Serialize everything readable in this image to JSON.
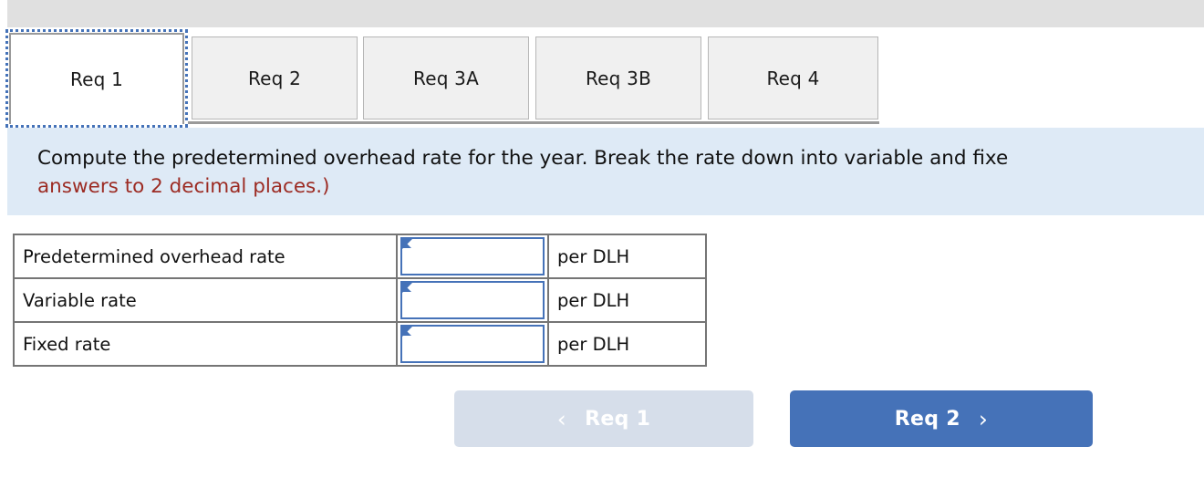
{
  "window": {
    "top_strip": ""
  },
  "tabs": {
    "active_index": 0,
    "items": [
      {
        "label": "Req 1",
        "active": true
      },
      {
        "label": "Req 2",
        "active": false
      },
      {
        "label": "Req 3A",
        "active": false
      },
      {
        "label": "Req 3B",
        "active": false
      },
      {
        "label": "Req 4",
        "active": false
      }
    ]
  },
  "instruction": {
    "line1": "Compute the predetermined overhead rate for the year. Break the rate down into variable and fixe",
    "line2": "answers to 2 decimal places.)",
    "background_color": "#deeaf6",
    "hint_color": "#9c2b23"
  },
  "answer_table": {
    "rows": [
      {
        "label": "Predetermined overhead rate",
        "value": "",
        "unit": "per DLH"
      },
      {
        "label": "Variable rate",
        "value": "",
        "unit": "per DLH"
      },
      {
        "label": "Fixed rate",
        "value": "",
        "unit": "per DLH"
      }
    ],
    "input_border_color": "#4572b8",
    "table_border_color": "#757575"
  },
  "navigation": {
    "prev": {
      "label": "Req 1",
      "icon": "chevron-left-icon",
      "glyph": "‹",
      "disabled": true,
      "color": "#d6deea"
    },
    "next": {
      "label": "Req 2",
      "icon": "chevron-right-icon",
      "glyph": "›",
      "disabled": false,
      "color": "#4572b8"
    }
  }
}
